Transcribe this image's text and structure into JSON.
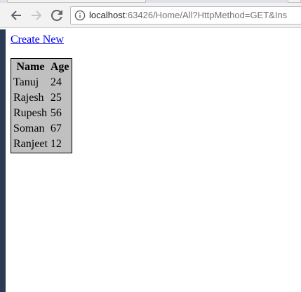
{
  "browser": {
    "address_host": "localhost",
    "address_rest": ":63426/Home/All?HttpMethod=GET&Ins"
  },
  "page": {
    "create_link": "Create New",
    "table": {
      "headers": [
        "Name",
        "Age"
      ],
      "rows": [
        [
          "Tanuj",
          "24"
        ],
        [
          "Rajesh",
          "25"
        ],
        [
          "Rupesh",
          "56"
        ],
        [
          "Soman",
          "67"
        ],
        [
          "Ranjeet",
          "12"
        ]
      ]
    }
  }
}
